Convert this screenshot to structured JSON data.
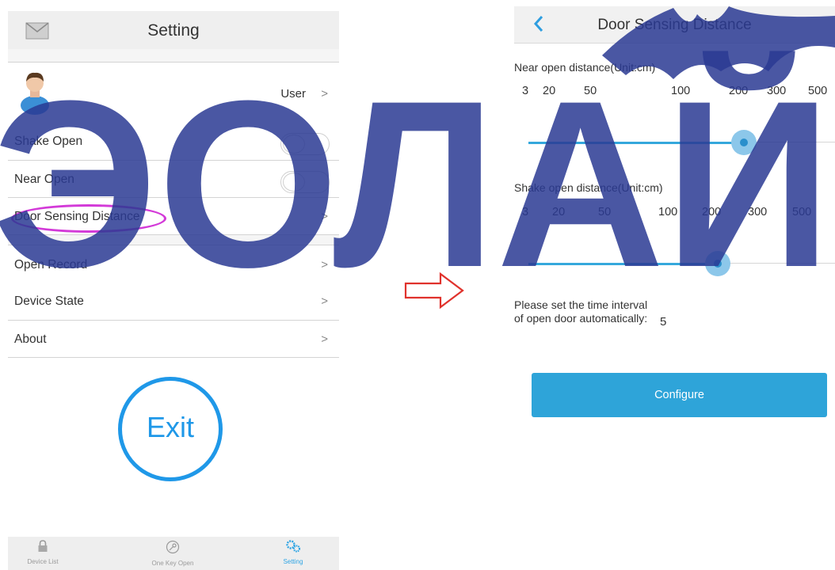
{
  "left": {
    "header_title": "Setting",
    "user_name": "User",
    "rows": {
      "shake_open": "Shake Open",
      "near_open": "Near Open",
      "door_sensing": "Door Sensing Distance",
      "open_record": "Open Record",
      "device_state": "Device State",
      "about": "About"
    },
    "chevron": ">",
    "exit_label": "Exit",
    "tabs": [
      {
        "label": "Device List",
        "icon": "lock-icon"
      },
      {
        "label": "One Key Open",
        "icon": "key-icon"
      },
      {
        "label": "Setting",
        "icon": "gears-icon",
        "active": true
      }
    ],
    "highlight_color": "#d33ad8",
    "accent": "#1f98e8"
  },
  "right": {
    "header_title": "Door Sensing Distance",
    "near_label": "Near open distance(Unit:cm)",
    "near_ticks": [
      "3",
      "20",
      "50",
      "100",
      "200",
      "300",
      "500"
    ],
    "near_value": 200,
    "shake_label": "Shake open distance(Unit:cm)",
    "shake_ticks": [
      "3",
      "20",
      "50",
      "100",
      "200",
      "300",
      "500"
    ],
    "shake_value": 200,
    "interval_label": "Please set the time interval of open door automatically:",
    "interval_value": "5",
    "configure_label": "Configure",
    "accent": "#2ea4d9"
  },
  "watermark": {
    "text": "ЭОЛАЙ",
    "color": "#2a3a93"
  }
}
